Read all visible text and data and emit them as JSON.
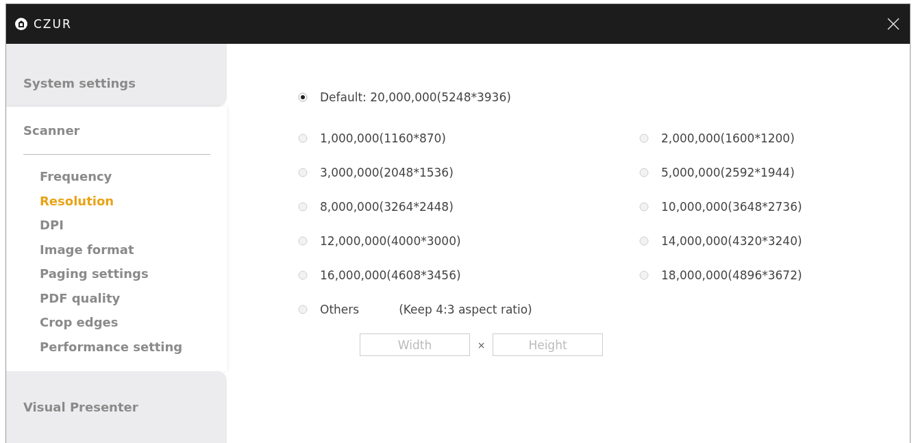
{
  "window": {
    "title": "CZUR"
  },
  "sidebar": {
    "sections": [
      {
        "label": "System settings",
        "selected": false
      },
      {
        "label": "Scanner",
        "selected": true,
        "children": [
          {
            "label": "Frequency",
            "selected": false
          },
          {
            "label": "Resolution",
            "selected": true
          },
          {
            "label": "DPI",
            "selected": false
          },
          {
            "label": "Image format",
            "selected": false
          },
          {
            "label": "Paging settings",
            "selected": false
          },
          {
            "label": "PDF quality",
            "selected": false
          },
          {
            "label": "Crop edges",
            "selected": false
          },
          {
            "label": "Performance setting",
            "selected": false
          }
        ]
      },
      {
        "label": "Visual Presenter",
        "selected": false
      }
    ]
  },
  "resolution": {
    "default": {
      "label": "Default: 20,000,000(5248*3936)",
      "selected": true
    },
    "options": [
      {
        "label": "1,000,000(1160*870)",
        "selected": false
      },
      {
        "label": "2,000,000(1600*1200)",
        "selected": false
      },
      {
        "label": "3,000,000(2048*1536)",
        "selected": false
      },
      {
        "label": "5,000,000(2592*1944)",
        "selected": false
      },
      {
        "label": "8,000,000(3264*2448)",
        "selected": false
      },
      {
        "label": "10,000,000(3648*2736)",
        "selected": false
      },
      {
        "label": "12,000,000(4000*3000)",
        "selected": false
      },
      {
        "label": "14,000,000(4320*3240)",
        "selected": false
      },
      {
        "label": "16,000,000(4608*3456)",
        "selected": false
      },
      {
        "label": "18,000,000(4896*3672)",
        "selected": false
      }
    ],
    "others": {
      "label": "Others",
      "note": "(Keep 4:3 aspect ratio)",
      "selected": false
    },
    "width_field": {
      "placeholder": "Width"
    },
    "separator": "×",
    "height_field": {
      "placeholder": "Height"
    }
  }
}
